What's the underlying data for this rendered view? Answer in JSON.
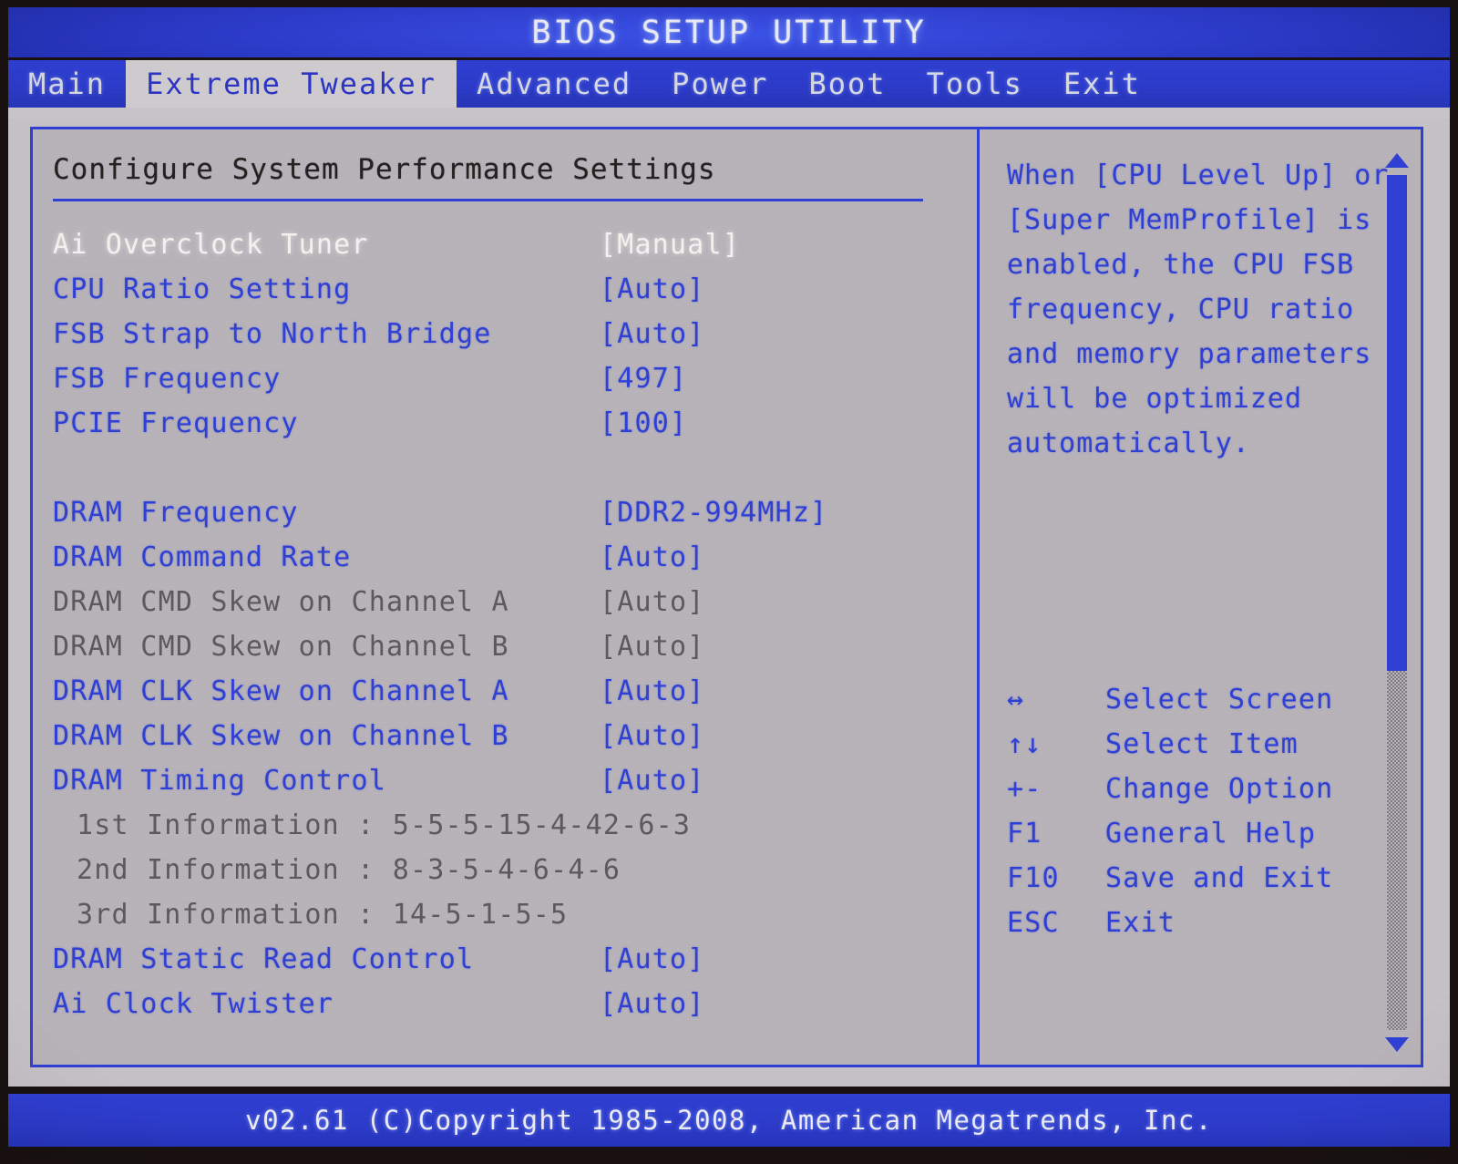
{
  "window": {
    "title": "BIOS SETUP UTILITY",
    "footer": "v02.61 (C)Copyright 1985-2008, American Megatrends, Inc."
  },
  "menubar": {
    "tabs": [
      {
        "label": "Main",
        "active": false
      },
      {
        "label": "Extreme Tweaker",
        "active": true
      },
      {
        "label": "Advanced",
        "active": false
      },
      {
        "label": "Power",
        "active": false
      },
      {
        "label": "Boot",
        "active": false
      },
      {
        "label": "Tools",
        "active": false
      },
      {
        "label": "Exit",
        "active": false
      }
    ]
  },
  "main": {
    "pane_title": "Configure System Performance Settings",
    "rows": [
      {
        "label": "Ai Overclock Tuner",
        "value": "[Manual]",
        "state": "selected"
      },
      {
        "label": "CPU Ratio Setting",
        "value": "[Auto]",
        "state": "normal"
      },
      {
        "label": "FSB Strap to North Bridge",
        "value": "[Auto]",
        "state": "normal"
      },
      {
        "label": "FSB Frequency",
        "value": "[497]",
        "state": "normal"
      },
      {
        "label": "PCIE Frequency",
        "value": "[100]",
        "state": "normal"
      },
      {
        "label": "",
        "value": "",
        "state": "spacer"
      },
      {
        "label": "DRAM Frequency",
        "value": "[DDR2-994MHz]",
        "state": "normal"
      },
      {
        "label": "DRAM Command Rate",
        "value": "[Auto]",
        "state": "normal"
      },
      {
        "label": "DRAM CMD Skew on Channel A",
        "value": "[Auto]",
        "state": "disabled"
      },
      {
        "label": "DRAM CMD Skew on Channel B",
        "value": "[Auto]",
        "state": "disabled"
      },
      {
        "label": "DRAM CLK Skew on Channel A",
        "value": "[Auto]",
        "state": "normal"
      },
      {
        "label": "DRAM CLK Skew on Channel B",
        "value": "[Auto]",
        "state": "normal"
      },
      {
        "label": "DRAM Timing Control",
        "value": "[Auto]",
        "state": "normal"
      },
      {
        "label": "1st Information : 5-5-5-15-4-42-6-3",
        "value": "",
        "state": "info"
      },
      {
        "label": "2nd Information : 8-3-5-4-6-4-6",
        "value": "",
        "state": "info"
      },
      {
        "label": "3rd Information : 14-5-1-5-5",
        "value": "",
        "state": "info"
      },
      {
        "label": "DRAM Static Read Control",
        "value": "[Auto]",
        "state": "normal"
      },
      {
        "label": "Ai Clock Twister",
        "value": "[Auto]",
        "state": "normal"
      }
    ],
    "scrollbar": {
      "up_arrow": "scroll-up-arrow",
      "down_arrow": "scroll-down-arrow",
      "thumb_fraction": 0.58
    }
  },
  "help": {
    "text": "When [CPU Level Up] or [Super MemProfile] is enabled, the CPU FSB frequency, CPU ratio and memory parameters will be optimized automatically.",
    "legend": [
      {
        "key": "↔",
        "desc": "Select Screen"
      },
      {
        "key": "↑↓",
        "desc": "Select Item"
      },
      {
        "key": "+-",
        "desc": "Change Option"
      },
      {
        "key": "F1",
        "desc": "General Help"
      },
      {
        "key": "F10",
        "desc": "Save and Exit"
      },
      {
        "key": "ESC",
        "desc": "Exit"
      }
    ]
  },
  "colors": {
    "accent_blue": "#2f3fd4",
    "panel_bg": "#b8b3b9",
    "selected_text": "#f4f2ee",
    "disabled_text": "#5c585c",
    "title_text": "#23201f"
  }
}
